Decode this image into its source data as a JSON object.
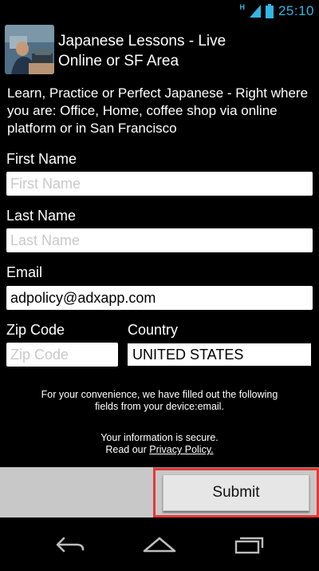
{
  "status_bar": {
    "network_type": "H",
    "time": "25:10",
    "icons": [
      "signal-icon",
      "battery-icon"
    ]
  },
  "header": {
    "title_line1": "Japanese Lessons - Live",
    "title_line2": "Online or SF Area"
  },
  "description": "Learn, Practice or Perfect Japanese - Right where you are: Office, Home, coffee shop via online platform or in San Francisco",
  "form": {
    "first_name": {
      "label": "First Name",
      "placeholder": "First Name",
      "value": ""
    },
    "last_name": {
      "label": "Last Name",
      "placeholder": "Last Name",
      "value": ""
    },
    "email": {
      "label": "Email",
      "placeholder": "",
      "value": "adpolicy@adxapp.com"
    },
    "zip_code": {
      "label": "Zip Code",
      "placeholder": "Zip Code",
      "value": ""
    },
    "country": {
      "label": "Country",
      "value": "UNITED STATES"
    }
  },
  "notes": {
    "prefill_line1": "For your convenience, we have filled out the following",
    "prefill_line2": "fields from your device:email.",
    "secure_line": "Your information is secure.",
    "read_our": "Read our ",
    "privacy_link": "Privacy Policy."
  },
  "submit_label": "Submit",
  "colors": {
    "status_accent": "#33b5e5",
    "highlight_border": "#e53935",
    "button_bar": "#c8c8c8"
  },
  "nav_bar": {
    "icons": [
      "back-icon",
      "home-icon",
      "recent-apps-icon"
    ]
  }
}
